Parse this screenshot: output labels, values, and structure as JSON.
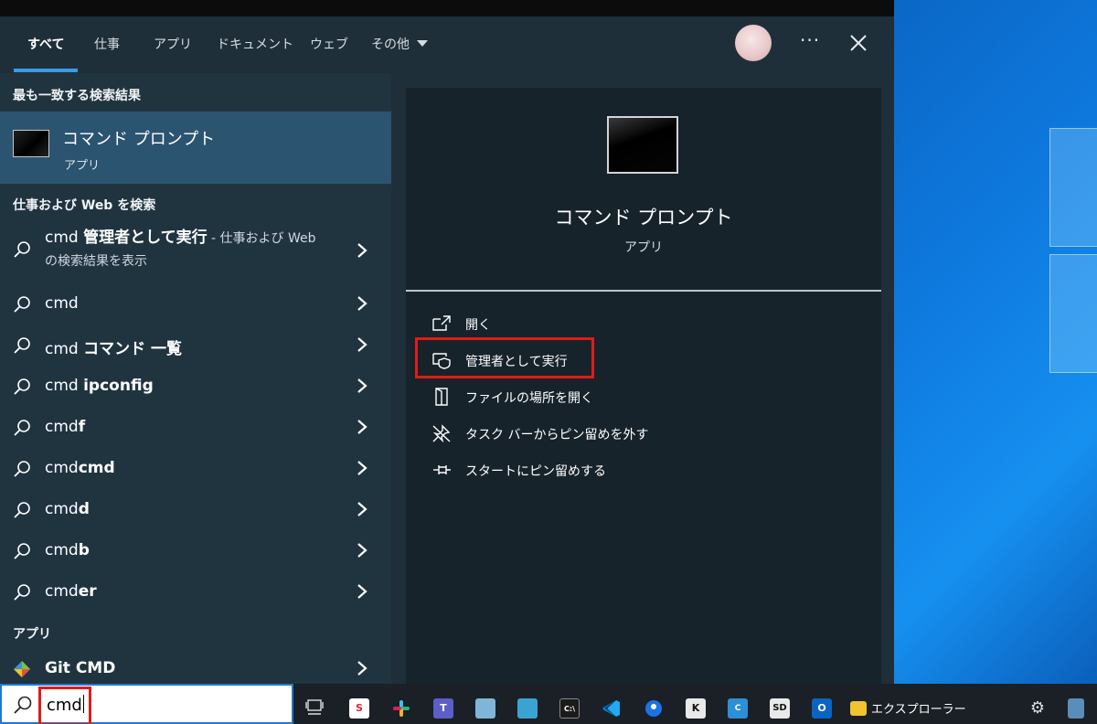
{
  "tabs": [
    {
      "label": "すべて"
    },
    {
      "label": "仕事"
    },
    {
      "label": "アプリ"
    },
    {
      "label": "ドキュメント"
    },
    {
      "label": "ウェブ"
    },
    {
      "label": "その他"
    }
  ],
  "best_match": {
    "heading": "最も一致する検索結果",
    "title": "コマンド プロンプト",
    "subtitle": "アプリ"
  },
  "web_section": {
    "heading": "仕事および Web を検索",
    "first_item": {
      "prefix": "cmd ",
      "bold": "管理者として実行",
      "suffix": " - 仕事および Web",
      "line2": "の検索結果を表示"
    },
    "items": [
      {
        "plain": "cmd",
        "bold": ""
      },
      {
        "plain": "cmd ",
        "bold": "コマンド 一覧"
      },
      {
        "plain": "cmd ",
        "bold": "ipconfig"
      },
      {
        "plain": "cmd",
        "bold": "f"
      },
      {
        "plain": "cmd",
        "bold": "cmd"
      },
      {
        "plain": "cmd",
        "bold": "d"
      },
      {
        "plain": "cmd",
        "bold": "b"
      },
      {
        "plain": "cmd",
        "bold": "er"
      }
    ]
  },
  "apps_section": {
    "heading": "アプリ",
    "items": [
      {
        "label": "Git CMD"
      }
    ]
  },
  "preview": {
    "title": "コマンド プロンプト",
    "subtitle": "アプリ",
    "actions": [
      {
        "label": "開く",
        "icon": "open-icon"
      },
      {
        "label": "管理者として実行",
        "icon": "shield-icon"
      },
      {
        "label": "ファイルの場所を開く",
        "icon": "file-location-icon"
      },
      {
        "label": "タスク バーからピン留めを外す",
        "icon": "unpin-icon"
      },
      {
        "label": "スタートにピン留めする",
        "icon": "pin-icon"
      }
    ]
  },
  "taskbar": {
    "search_query": "cmd",
    "explorer_label": "エクスプローラー",
    "apps": [
      "task-view-icon",
      "app-s-icon",
      "slack-icon",
      "teams-icon",
      "notepad-icon",
      "building-icon",
      "terminal-icon",
      "vscode-icon",
      "maps-icon",
      "k-app-icon",
      "app-blue-icon",
      "app-sd-icon",
      "outlook-icon",
      "explorer-icon",
      "settings-icon",
      "network-icon"
    ]
  },
  "colors": {
    "accent": "#3a9be8",
    "selected_row": "#2b5470",
    "highlight_border": "#e01b1b"
  }
}
